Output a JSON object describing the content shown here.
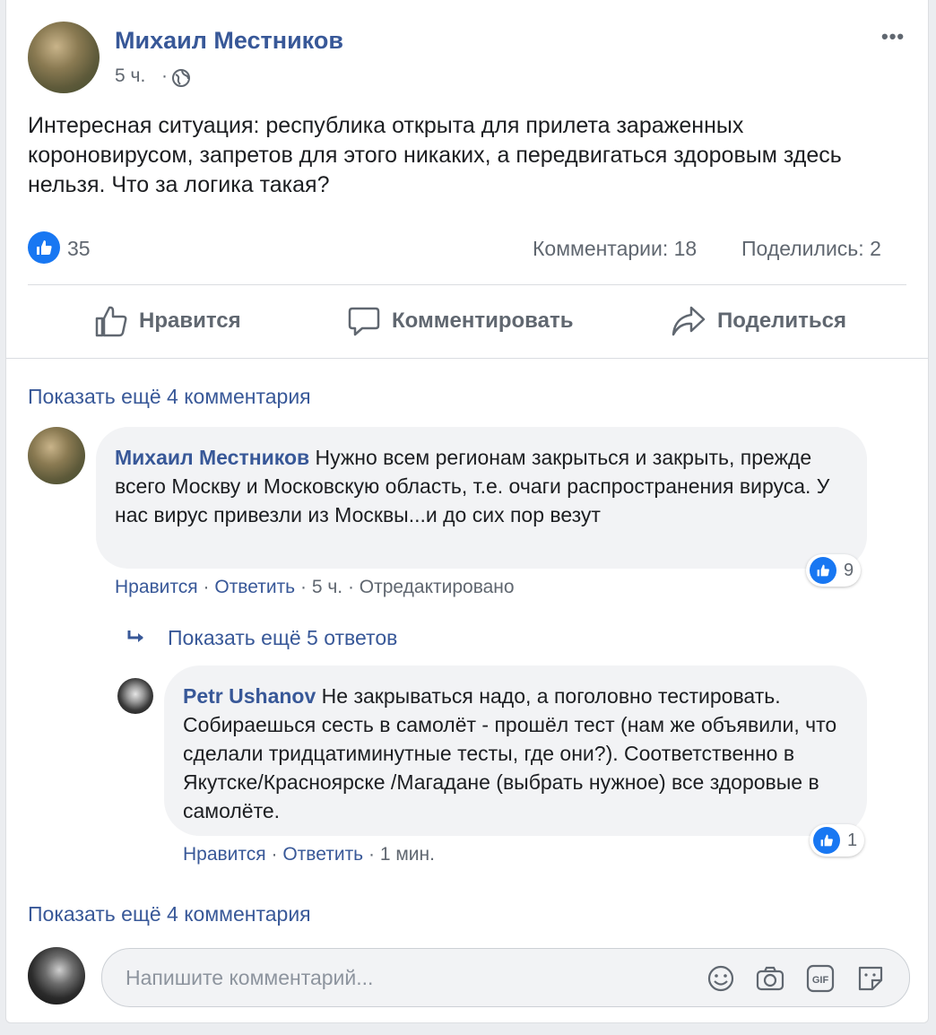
{
  "post": {
    "author": "Михаил Местников",
    "time": "5 ч.",
    "time_sep": "·",
    "menu": "•••",
    "text": "Интересная ситуация: республика открыта для прилета зараженных короновирусом, запретов для этого никаких, а передвигаться здоровым здесь нельзя. Что за логика такая?",
    "likes": "35",
    "comments_count": "Комментарии: 18",
    "shares_count": "Поделились: 2"
  },
  "actions": {
    "like": "Нравится",
    "comment": "Комментировать",
    "share": "Поделиться"
  },
  "comments": {
    "show_more_top": "Показать ещё 4 комментария",
    "c1": {
      "author": "Михаил Местников",
      "text": "Нужно всем регионам закрыться и закрыть, прежде всего Москву и Московскую область, т.е. очаги распространения вируса. У нас вирус привезли из Москвы...и до сих пор везут",
      "like": "Нравится",
      "reply": "Ответить",
      "time": "5 ч.",
      "edited": "Отредактировано",
      "reactions": "9"
    },
    "show_replies": "Показать ещё 5 ответов",
    "r1": {
      "author": "Petr Ushanov",
      "text": "Не закрываться надо, а поголовно тестировать. Собираешься сесть в самолёт - прошёл тест (нам же объявили, что сделали тридцатиминутные тесты, где они?). Соответственно в Якутске/Красноярске /Магадане (выбрать нужное) все здоровые в самолёте.",
      "like": "Нравится",
      "reply": "Ответить",
      "time": "1 мин.",
      "reactions": "1"
    },
    "show_more_bottom": "Показать ещё 4 комментария",
    "input_placeholder": "Напишите комментарий..."
  },
  "colors": {
    "link": "#385898",
    "like_blue": "#1877f2",
    "muted": "#606770"
  },
  "icons": [
    "globe-icon",
    "like-icon",
    "thumbs-up-icon",
    "comment-icon",
    "share-icon",
    "reply-arrow-icon",
    "emoji-icon",
    "camera-icon",
    "gif-icon",
    "sticker-icon",
    "more-icon"
  ]
}
